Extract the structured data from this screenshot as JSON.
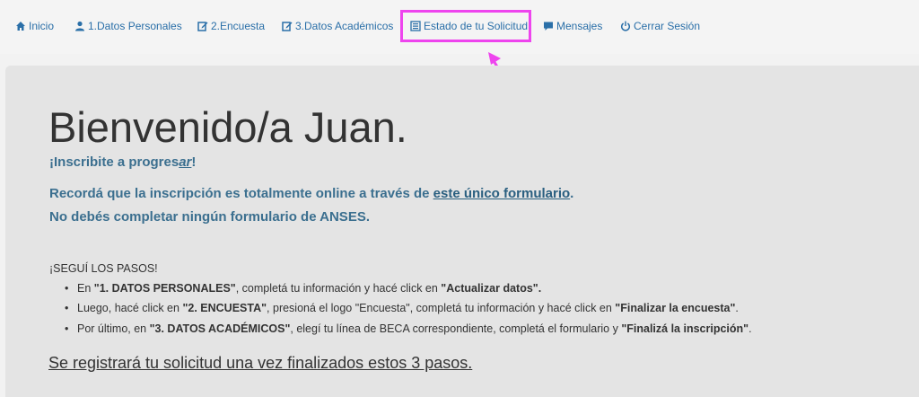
{
  "nav": {
    "items": [
      {
        "label": "Inicio",
        "icon": "home-icon"
      },
      {
        "label": "1.Datos Personales",
        "icon": "user-icon"
      },
      {
        "label": "2.Encuesta",
        "icon": "edit-icon"
      },
      {
        "label": "3.Datos Académicos",
        "icon": "edit-icon"
      },
      {
        "label": "Estado de tu Solicitud",
        "icon": "list-icon"
      },
      {
        "label": "Mensajes",
        "icon": "message-icon"
      },
      {
        "label": "Cerrar Sesión",
        "icon": "power-icon"
      }
    ],
    "highlight_color": "#ee44ee"
  },
  "main": {
    "title": "Bienvenido/a Juan.",
    "subtitle_prefix": "¡Inscribite a progres",
    "subtitle_em": "ar",
    "subtitle_suffix": "!",
    "info_line1_prefix": "Recordá que la inscripción es totalmente online a través de ",
    "info_line1_link": "este único formulario",
    "info_line1_suffix": ".",
    "info_line2": "No debés completar ningún formulario de ANSES.",
    "steps_title": "¡SEGUÍ LOS PASOS!",
    "steps": [
      {
        "t1": "En ",
        "b1": "\"1. DATOS PERSONALES\"",
        "t2": ", completá tu información y hacé click en ",
        "b2": "\"Actualizar datos\".",
        "t3": ""
      },
      {
        "t1": "Luego, hacé click en ",
        "b1": "\"2. ENCUESTA\"",
        "t2": ", presioná el logo \"Encuesta\", completá tu información y hacé click en ",
        "b2": "\"Finalizar la encuesta\"",
        "t3": "."
      },
      {
        "t1": "Por último, en ",
        "b1": "\"3. DATOS ACADÉMICOS\"",
        "t2": ", elegí tu línea de BECA correspondiente, completá el formulario y ",
        "b2": "\"Finalizá la inscripción\"",
        "t3": "."
      }
    ],
    "final": "Se registrará tu solicitud una vez finalizados estos 3 pasos."
  },
  "colors": {
    "link": "#2a6fa8",
    "info": "#3b6f8f",
    "panel": "#e4e4e4"
  }
}
